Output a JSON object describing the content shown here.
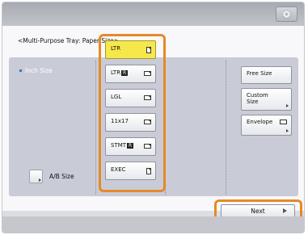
{
  "header": {
    "title": "<Multi-Purpose Tray: Paper Size>",
    "top_icon": "settings-icon"
  },
  "sidebar": {
    "inch_label": "Inch Size",
    "ab_label": "A/B Size"
  },
  "sizes": [
    {
      "label": "LTR",
      "badge": "",
      "orientation": "portrait",
      "selected": true
    },
    {
      "label": "LTR",
      "badge": "R",
      "orientation": "landscape",
      "selected": false
    },
    {
      "label": "LGL",
      "badge": "",
      "orientation": "landscape",
      "selected": false
    },
    {
      "label": "11x17",
      "badge": "",
      "orientation": "landscape",
      "selected": false
    },
    {
      "label": "STMT",
      "badge": "R",
      "orientation": "landscape",
      "selected": false
    },
    {
      "label": "EXEC",
      "badge": "",
      "orientation": "portrait",
      "selected": false
    }
  ],
  "options": {
    "free_size": "Free Size",
    "custom_size_line1": "Custom",
    "custom_size_line2": "Size",
    "envelope": "Envelope"
  },
  "footer": {
    "next_label": "Next"
  },
  "colors": {
    "highlight": "#e58a28",
    "selected": "#f6e84a",
    "panel": "#c9ccd6"
  }
}
